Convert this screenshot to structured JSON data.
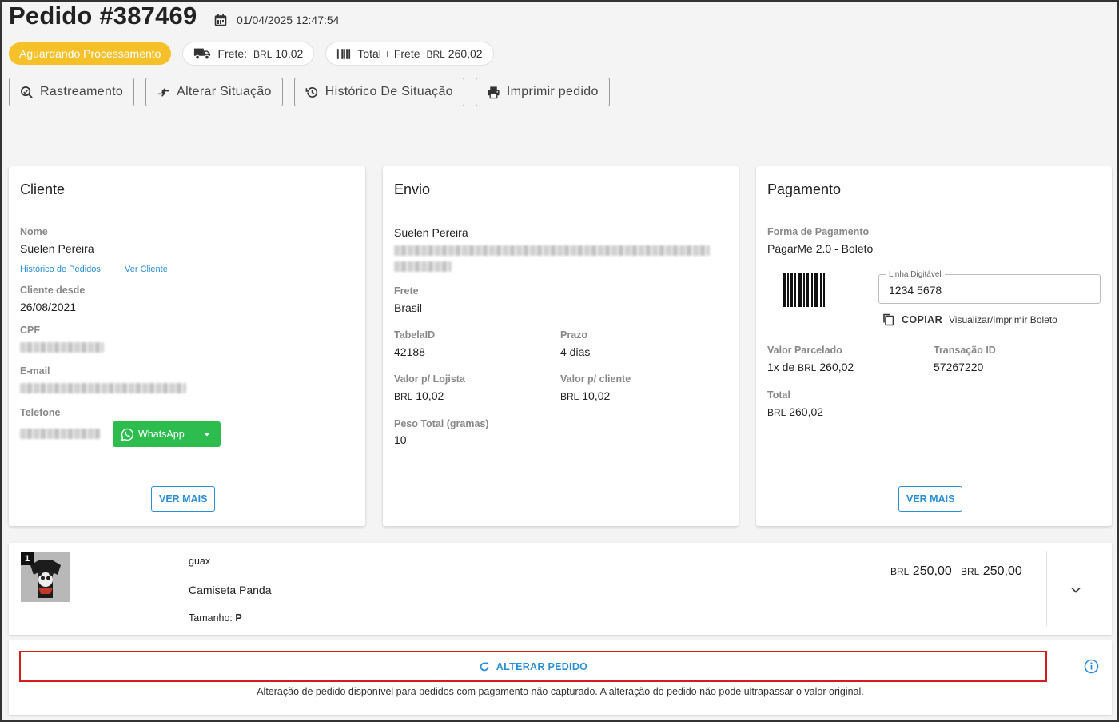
{
  "header": {
    "title": "Pedido #387469",
    "datetime": "01/04/2025 12:47:54",
    "status": "Aguardando Processamento",
    "frete_label": "Frete:",
    "frete_currency": "BRL",
    "frete_value": "10,02",
    "total_label": "Total + Frete",
    "total_currency": "BRL",
    "total_value": "260,02"
  },
  "actions": {
    "rastreamento": "Rastreamento",
    "alterar_situacao": "Alterar Situação",
    "historico_situacao": "Histórico De Situação",
    "imprimir": "Imprimir pedido"
  },
  "cliente": {
    "title": "Cliente",
    "nome_label": "Nome",
    "nome": "Suelen Pereira",
    "historico_link": "Histórico de Pedidos",
    "ver_cliente_link": "Ver Cliente",
    "desde_label": "Cliente desde",
    "desde": "26/08/2021",
    "cpf_label": "CPF",
    "email_label": "E-mail",
    "telefone_label": "Telefone",
    "whatsapp": "WhatsApp",
    "ver_mais": "VER MAIS"
  },
  "envio": {
    "title": "Envio",
    "nome": "Suelen Pereira",
    "frete_label": "Frete",
    "frete": "Brasil",
    "tabela_label": "TabelaID",
    "tabela": "42188",
    "prazo_label": "Prazo",
    "prazo": "4 dias",
    "valor_lojista_label": "Valor p/ Lojista",
    "valor_lojista_currency": "BRL",
    "valor_lojista": "10,02",
    "valor_cliente_label": "Valor p/ cliente",
    "valor_cliente_currency": "BRL",
    "valor_cliente": "10,02",
    "peso_label": "Peso Total (gramas)",
    "peso": "10"
  },
  "pagamento": {
    "title": "Pagamento",
    "forma_label": "Forma de Pagamento",
    "forma": "PagarMe 2.0 - Boleto",
    "linha_label": "Linha Digitável",
    "linha": "1234 5678",
    "copiar": "COPIAR",
    "visualizar": "Visualizar/Imprimir Boleto",
    "parcelado_label": "Valor Parcelado",
    "parcelado_prefix": "1x de",
    "parcelado_currency": "BRL",
    "parcelado": "260,02",
    "transacao_label": "Transação ID",
    "transacao": "57267220",
    "total_label": "Total",
    "total_currency": "BRL",
    "total": "260,02",
    "ver_mais": "VER MAIS"
  },
  "item": {
    "qty": "1",
    "brand": "guax",
    "name": "Camiseta Panda",
    "size_label": "Tamanho:",
    "size": "P",
    "price_currency": "BRL",
    "price": "250,00",
    "total_currency": "BRL",
    "total": "250,00"
  },
  "alterar": {
    "button": "ALTERAR PEDIDO",
    "note": "Alteração de pedido disponível para pedidos com pagamento não capturado. A alteração do pedido não pode ultrapassar o valor original."
  },
  "colors": {
    "status": "#f5c028",
    "link": "#2b8fd6",
    "whatsapp": "#2dbd4f",
    "highlight": "#d61c1c"
  }
}
